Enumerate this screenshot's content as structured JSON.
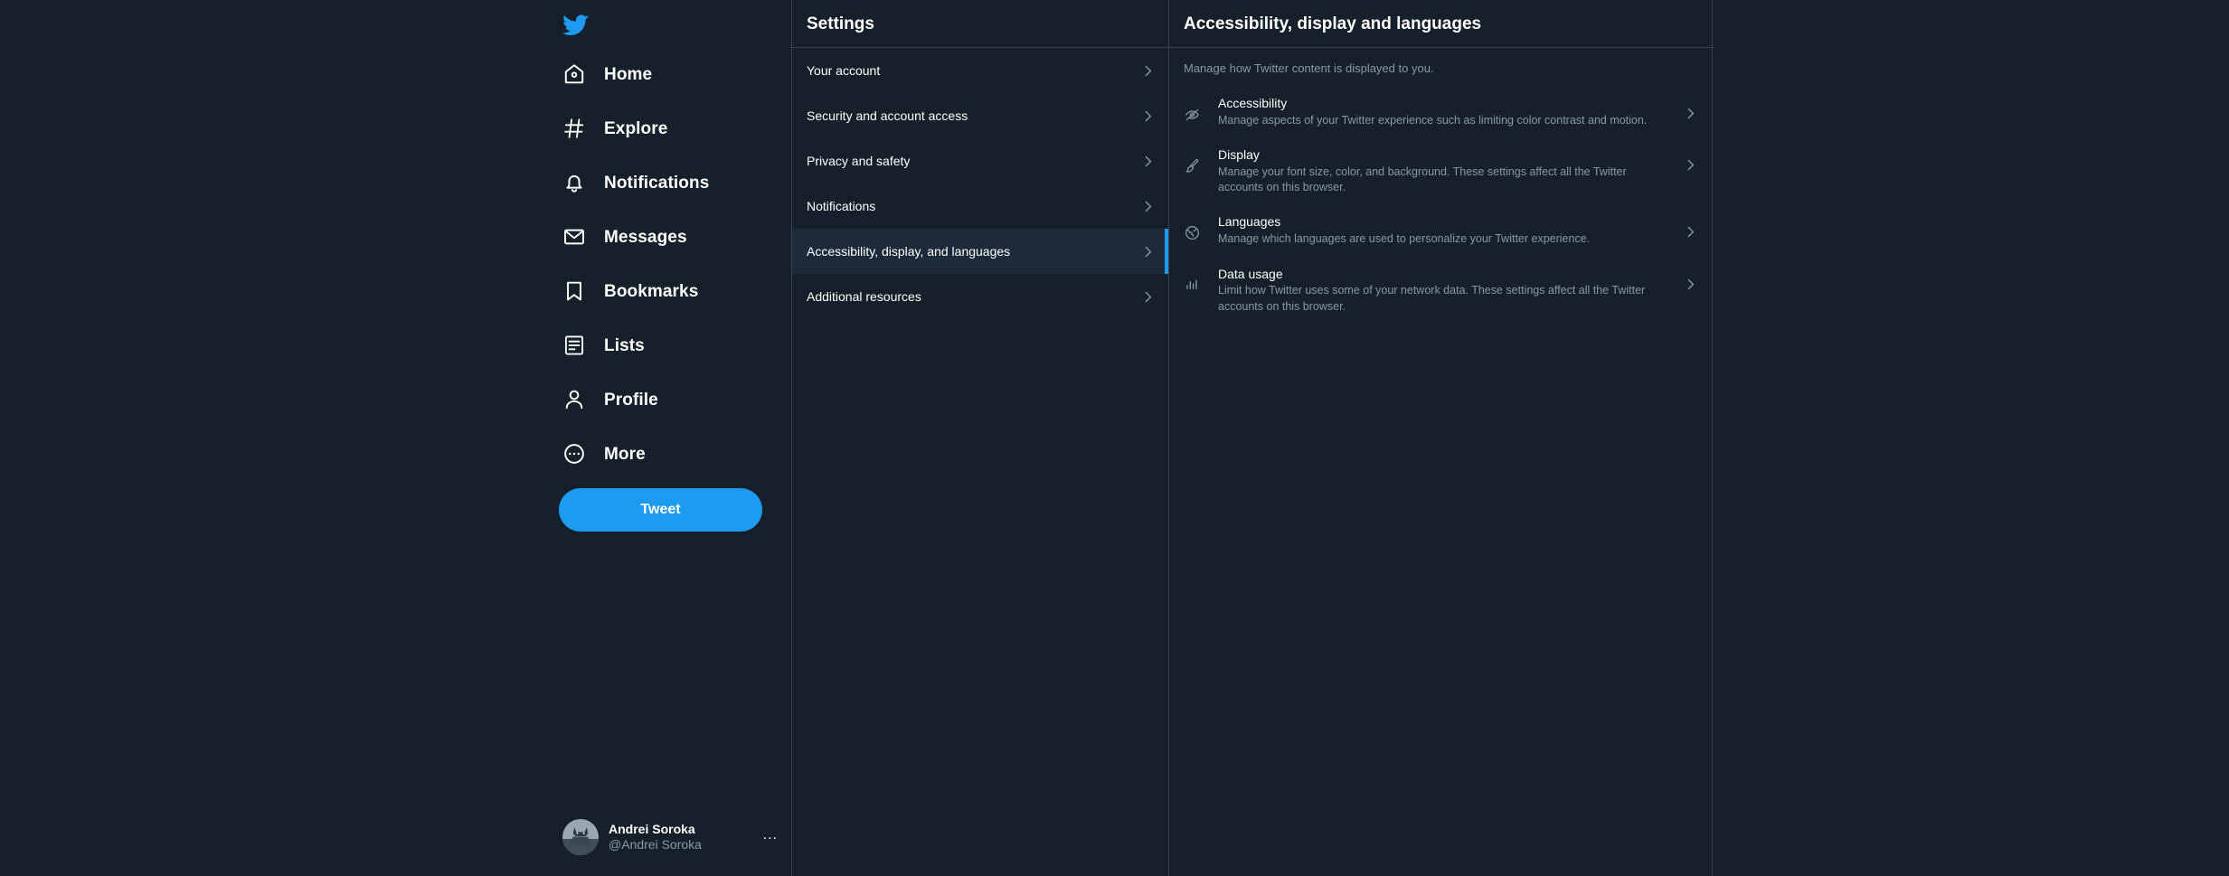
{
  "theme": {
    "background": "#15202b",
    "accent": "#1d9bf0",
    "border": "#38444d",
    "muted_text": "#8899a6",
    "primary_text": "#ffffff",
    "selected_row_bg": "#1c2a39"
  },
  "sidebar": {
    "logo_name": "twitter-bird-logo",
    "items": [
      {
        "label": "Home",
        "icon": "home-icon"
      },
      {
        "label": "Explore",
        "icon": "hashtag-icon"
      },
      {
        "label": "Notifications",
        "icon": "bell-icon"
      },
      {
        "label": "Messages",
        "icon": "envelope-icon"
      },
      {
        "label": "Bookmarks",
        "icon": "bookmark-icon"
      },
      {
        "label": "Lists",
        "icon": "list-icon"
      },
      {
        "label": "Profile",
        "icon": "person-icon"
      },
      {
        "label": "More",
        "icon": "more-circle-icon"
      }
    ],
    "tweet_button": "Tweet",
    "account": {
      "display_name": "Andrei Soroka",
      "handle": "@Andrei Soroka",
      "avatar_name": "batman-avatar",
      "more_options": "..."
    }
  },
  "settings_panel": {
    "title": "Settings",
    "items": [
      {
        "label": "Your account",
        "selected": false
      },
      {
        "label": "Security and account access",
        "selected": false
      },
      {
        "label": "Privacy and safety",
        "selected": false
      },
      {
        "label": "Notifications",
        "selected": false
      },
      {
        "label": "Accessibility, display, and languages",
        "selected": true
      },
      {
        "label": "Additional resources",
        "selected": false
      }
    ]
  },
  "detail_panel": {
    "title": "Accessibility, display and languages",
    "subtitle": "Manage how Twitter content is displayed to you.",
    "options": [
      {
        "title": "Accessibility",
        "description": "Manage aspects of your Twitter experience such as limiting color contrast and motion.",
        "icon": "eye-slash-icon"
      },
      {
        "title": "Display",
        "description": "Manage your font size, color, and background. These settings affect all the Twitter accounts on this browser.",
        "icon": "paintbrush-icon"
      },
      {
        "title": "Languages",
        "description": "Manage which languages are used to personalize your Twitter experience.",
        "icon": "globe-icon"
      },
      {
        "title": "Data usage",
        "description": "Limit how Twitter uses some of your network data. These settings affect all the Twitter accounts on this browser.",
        "icon": "bar-chart-icon"
      }
    ]
  }
}
